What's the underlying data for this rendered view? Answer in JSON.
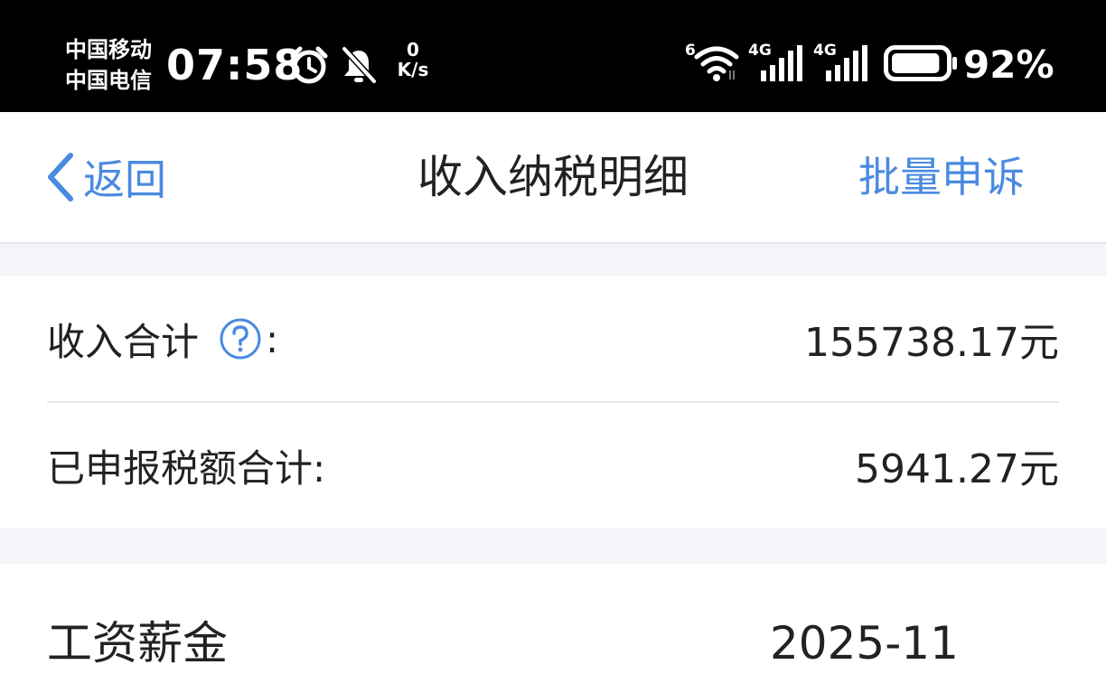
{
  "status_bar": {
    "carrier_1": "中国移动",
    "carrier_2": "中国电信",
    "time": "07:58",
    "net_speed_value": "0",
    "net_speed_unit": "K/s",
    "wifi_label": "6",
    "sim1_label": "4G",
    "sim2_label": "4G",
    "battery_level": 0.92,
    "battery_percent": "92%",
    "icons": [
      "alarm-icon",
      "bell-muted-icon",
      "wifi-icon",
      "signal-icon",
      "battery-icon"
    ]
  },
  "nav": {
    "back_label": "返回",
    "title": "收入纳税明细",
    "action_label": "批量申诉"
  },
  "summary": {
    "income_label": "收入合计",
    "income_colon": ":",
    "income_value": "155738.17元",
    "tax_label": "已申报税额合计:",
    "tax_value": "5941.27元"
  },
  "records": [
    {
      "type": "工资薪金",
      "period": "2025-11"
    }
  ],
  "colors": {
    "accent": "#4a8ae0",
    "text": "#222222",
    "background_gap": "#f3f5f8",
    "status_bar": "#000000"
  }
}
